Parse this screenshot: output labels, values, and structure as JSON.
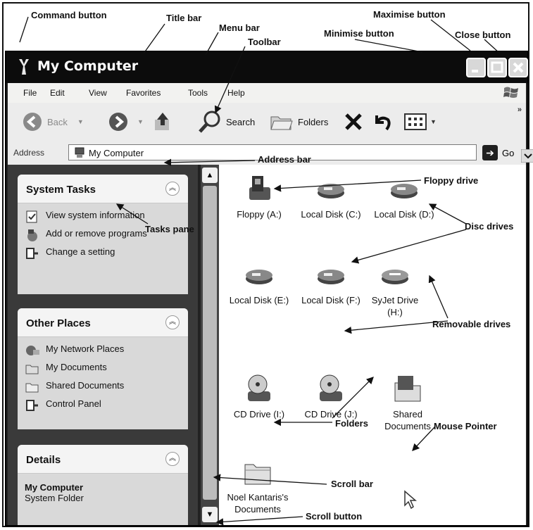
{
  "window": {
    "title": "My Computer",
    "buttons": {
      "minimise": "minimise-icon",
      "maximise": "maximise-icon",
      "close": "close-icon"
    }
  },
  "menu": [
    "File",
    "Edit",
    "View",
    "Favorites",
    "Tools",
    "Help"
  ],
  "toolbar": {
    "back": "Back",
    "search": "Search",
    "folders": "Folders"
  },
  "address": {
    "label": "Address",
    "value": "My Computer",
    "go": "Go"
  },
  "tasks": {
    "system_tasks": {
      "title": "System Tasks",
      "items": [
        "View system information",
        "Add or remove programs",
        "Change a setting"
      ]
    },
    "other_places": {
      "title": "Other Places",
      "items": [
        "My Network Places",
        "My Documents",
        "Shared Documents",
        "Control Panel"
      ]
    },
    "details": {
      "title": "Details",
      "name": "My Computer",
      "type": "System Folder"
    }
  },
  "drives": [
    {
      "label": "Floppy (A:)",
      "icon": "floppy-drive-icon"
    },
    {
      "label": "Local Disk (C:)",
      "icon": "hard-disk-icon"
    },
    {
      "label": "Local Disk (D:)",
      "icon": "hard-disk-icon"
    },
    {
      "label": "Local Disk (E:)",
      "icon": "hard-disk-icon"
    },
    {
      "label": "Local Disk (F:)",
      "icon": "hard-disk-icon"
    },
    {
      "label": "SyJet Drive (H:)",
      "icon": "removable-drive-icon"
    },
    {
      "label": "CD Drive (I:)",
      "icon": "cd-drive-icon"
    },
    {
      "label": "CD Drive (J:)",
      "icon": "cd-drive-icon"
    },
    {
      "label": "Shared Documents",
      "icon": "shared-folder-icon"
    },
    {
      "label": "Noel Kantaris's Documents",
      "icon": "folder-icon"
    }
  ],
  "callouts": {
    "command_button": "Command button",
    "title_bar": "Title bar",
    "menu_bar": "Menu bar",
    "toolbar": "Toolbar",
    "minimise_button": "Minimise button",
    "maximise_button": "Maximise button",
    "close_button": "Close button",
    "address_bar": "Address bar",
    "tasks_pane": "Tasks pane",
    "floppy_drive": "Floppy drive",
    "disc_drives": "Disc drives",
    "removable_drives": "Removable drives",
    "folders": "Folders",
    "mouse_pointer": "Mouse Pointer",
    "scroll_bar": "Scroll bar",
    "scroll_button": "Scroll button"
  }
}
